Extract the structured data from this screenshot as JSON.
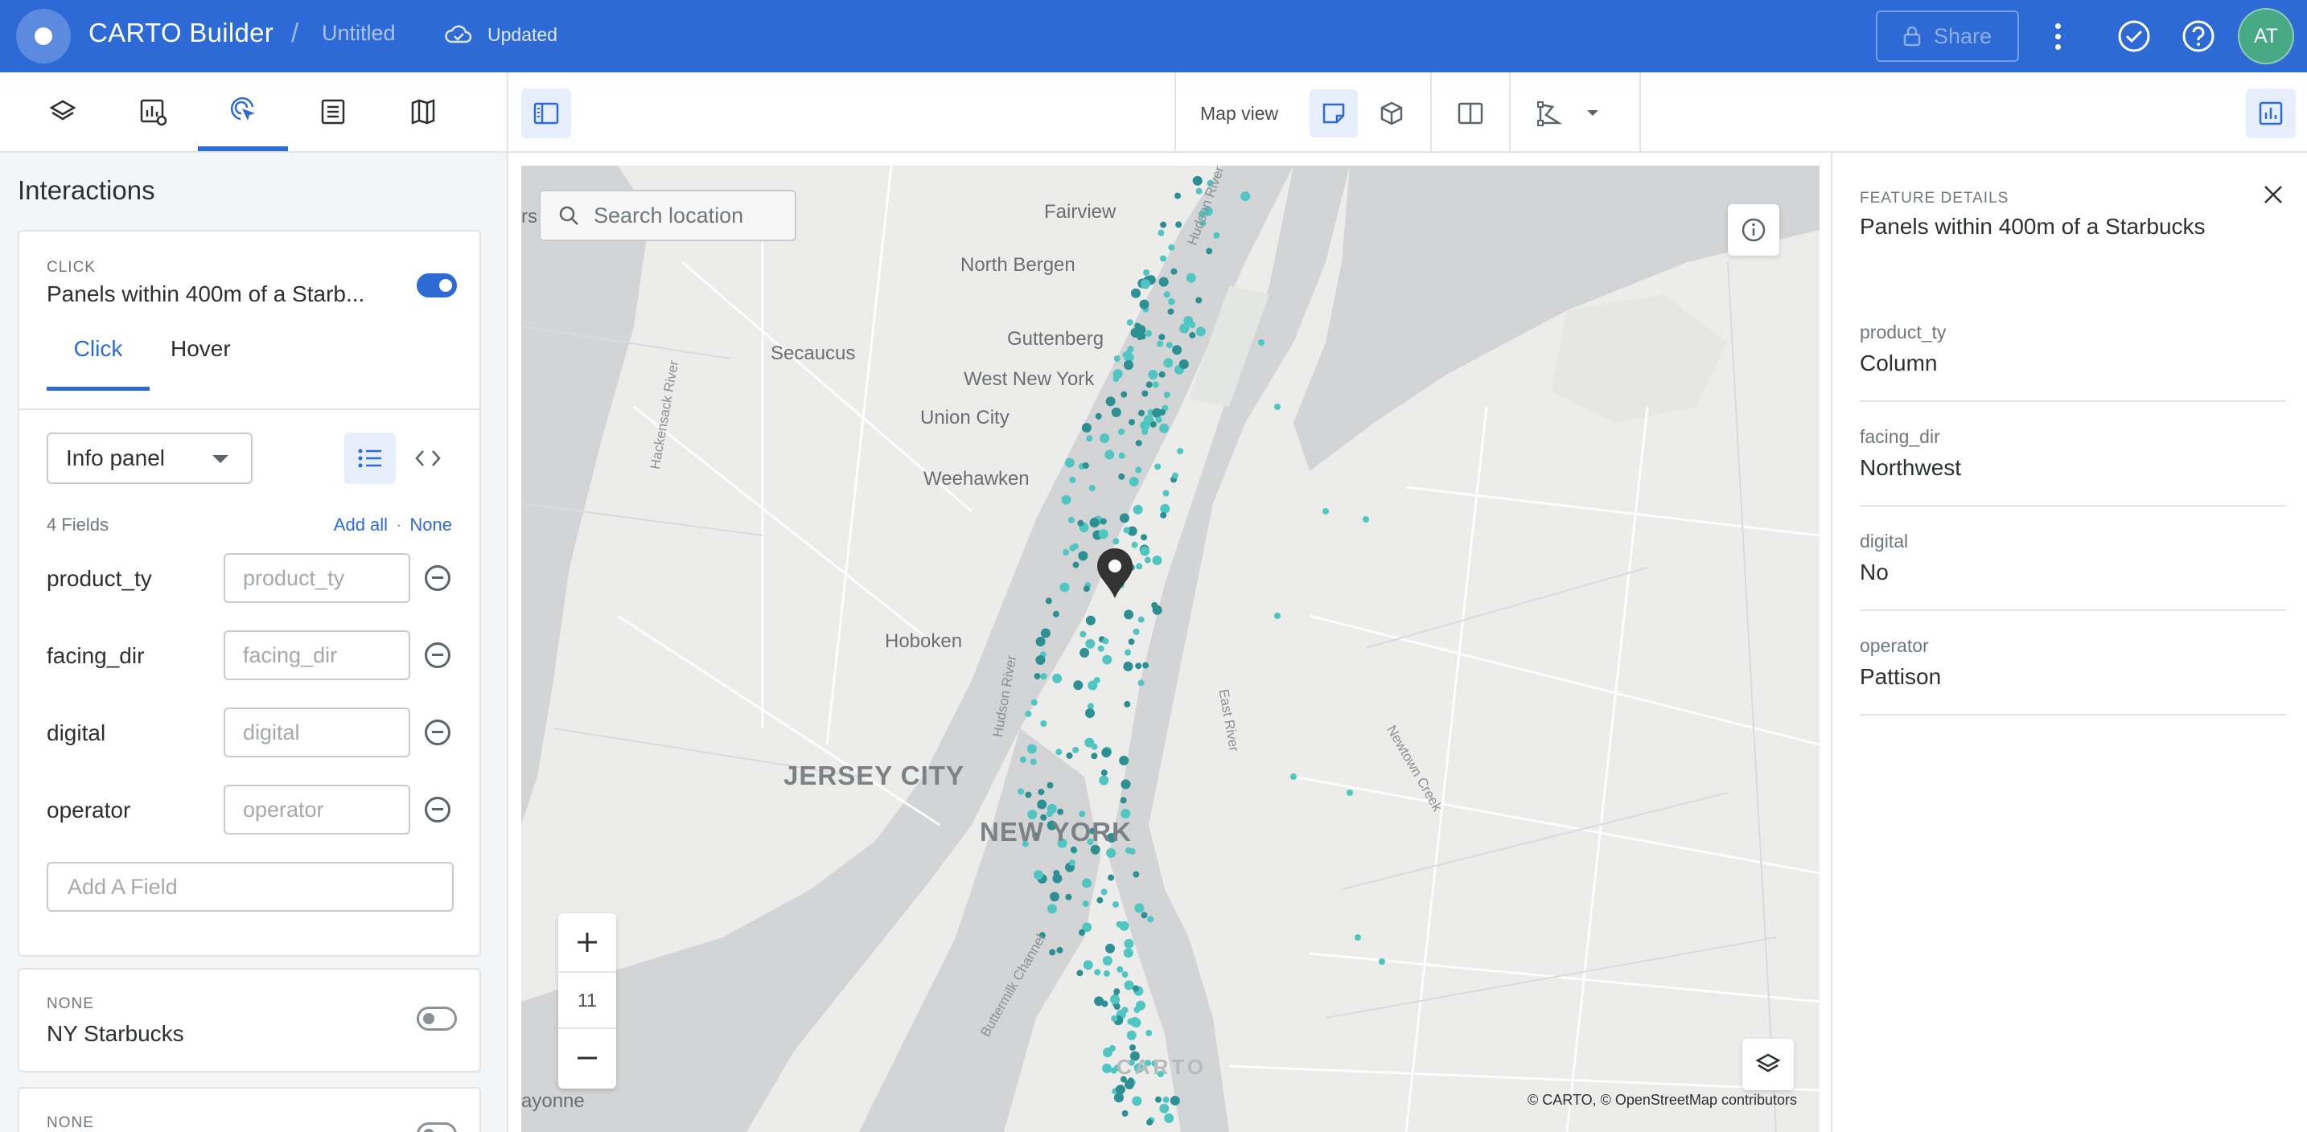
{
  "header": {
    "app_title": "CARTO Builder",
    "separator": "/",
    "map_name": "Untitled",
    "save_status": "Updated",
    "share_label": "Share",
    "avatar_initials": "AT",
    "bar_color": "#2d6ad6"
  },
  "toolbar": {
    "tabs": [
      {
        "icon": "layers-icon",
        "active": false
      },
      {
        "icon": "widgets-icon",
        "active": false
      },
      {
        "icon": "interactions-icon",
        "active": true
      },
      {
        "icon": "legend-icon",
        "active": false
      },
      {
        "icon": "basemap-icon",
        "active": false
      }
    ],
    "map_view_label": "Map view"
  },
  "interactions": {
    "title": "Interactions",
    "card": {
      "kicker": "CLICK",
      "layer_name": "Panels within 400m of a Starb...",
      "enabled": true,
      "tabs": [
        "Click",
        "Hover"
      ],
      "active_tab": "Click",
      "style_select": "Info panel",
      "fields_count": "4 Fields",
      "add_all": "Add all",
      "dot": "·",
      "none": "None",
      "fields": [
        {
          "name": "product_ty",
          "placeholder": "product_ty"
        },
        {
          "name": "facing_dir",
          "placeholder": "facing_dir"
        },
        {
          "name": "digital",
          "placeholder": "digital"
        },
        {
          "name": "operator",
          "placeholder": "operator"
        }
      ],
      "add_field_placeholder": "Add A Field"
    },
    "other_layers": [
      {
        "kicker": "NONE",
        "name": "NY Starbucks",
        "enabled": false
      },
      {
        "kicker": "NONE",
        "name": "",
        "enabled": false
      }
    ]
  },
  "map": {
    "search_placeholder": "Search location",
    "zoom_level": "11",
    "zoom_in": "+",
    "zoom_out": "−",
    "attribution": "© CARTO, © OpenStreetMap contributors",
    "watermark": "CARTO",
    "labels": {
      "fairview": "Fairview",
      "north_bergen": "North Bergen",
      "secaucus": "Secaucus",
      "guttenberg": "Guttenberg",
      "west_new_york": "West New York",
      "union_city": "Union City",
      "weehawken": "Weehawken",
      "hoboken": "Hoboken",
      "jersey_city": "JERSEY CITY",
      "new_york": "NEW YORK",
      "bayonne": "ayonne",
      "edge_rs": "rs",
      "hudson_river": "Hudson River",
      "east_river": "East River",
      "buttermilk": "Buttermilk Channel",
      "newtown_creek": "Newtown Creek",
      "hackensack": "Hackensack River"
    },
    "point_colors": [
      "#4fc6c1",
      "#2c8f92"
    ]
  },
  "feature_details": {
    "kicker": "FEATURE DETAILS",
    "title": "Panels within 400m of a Starbucks",
    "rows": [
      {
        "label": "product_ty",
        "value": "Column"
      },
      {
        "label": "facing_dir",
        "value": "Northwest"
      },
      {
        "label": "digital",
        "value": "No"
      },
      {
        "label": "operator",
        "value": "Pattison"
      }
    ]
  }
}
